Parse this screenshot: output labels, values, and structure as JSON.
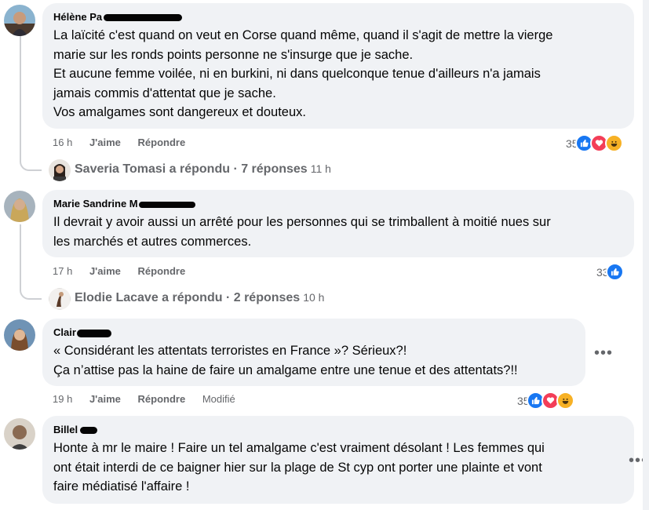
{
  "comments": [
    {
      "author": "Hélène Pa",
      "lines": [
        "La laïcité c'est quand on veut en Corse quand même, quand il s'agit de mettre la vierge",
        "marie sur les ronds points personne ne s'insurge que je sache.",
        "Et aucune femme voilée, ni en burkini, ni dans quelconque tenue d'ailleurs n'a jamais",
        "jamais commis d'attentat que je sache.",
        "Vos amalgames sont dangereux et douteux."
      ],
      "time": "16 h",
      "like": "J'aime",
      "reply": "Répondre",
      "reaction_count": "35",
      "reactions": [
        "like-icon",
        "love-icon",
        "haha-icon"
      ],
      "replies_summary": {
        "text": "Saveria Tomasi a répondu · 7 réponses",
        "time": "11 h"
      }
    },
    {
      "author": "Marie Sandrine M",
      "lines": [
        "Il devrait y avoir aussi un arrêté pour les personnes qui se trimballent à moitié nues sur",
        "les marchés et autres commerces."
      ],
      "time": "17 h",
      "like": "J'aime",
      "reply": "Répondre",
      "reaction_count": "33",
      "reactions": [
        "like-icon"
      ],
      "replies_summary": {
        "text": "Elodie Lacave a répondu · 2 réponses",
        "time": "10 h"
      }
    },
    {
      "author": "Clair",
      "lines": [
        "« Considérant les attentats terroristes en France »? Sérieux?!",
        "Ça n’attise pas la haine de faire un amalgame entre une tenue et des attentats?!!"
      ],
      "time": "19 h",
      "like": "J'aime",
      "reply": "Répondre",
      "edited": "Modifié",
      "reaction_count": "35",
      "reactions": [
        "like-icon",
        "love-icon",
        "haha-icon"
      ],
      "more": "•••"
    },
    {
      "author": "Billel",
      "lines": [
        "Honte à mr le maire ! Faire un tel amalgame c'est vraiment désolant ! Les femmes qui",
        "ont était interdi de ce baigner hier sur la plage de St cyp ont porter une plainte et vont",
        "faire médiatisé l'affaire !"
      ],
      "more": "•••"
    }
  ],
  "colors": {
    "bubble": "#f0f2f5",
    "meta": "#65676b",
    "like": "#1877f2",
    "love": "#f33e58",
    "haha": "#f7b125"
  }
}
